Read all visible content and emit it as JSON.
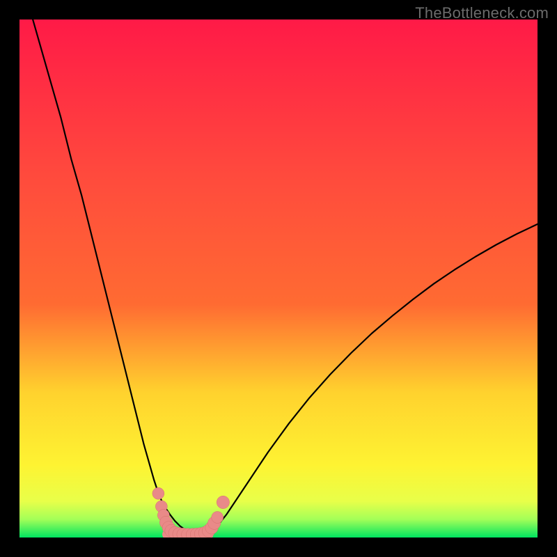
{
  "watermark": "TheBottleneck.com",
  "colors": {
    "bg": "#000000",
    "grad_top": "#ff1a47",
    "grad_mid_upper": "#ff6b32",
    "grad_mid": "#ffd22e",
    "grad_mid_lower": "#fef332",
    "grad_low": "#e8ff49",
    "grad_bottom": "#00e560",
    "curve": "#000000",
    "marker_fill": "#e98a88",
    "marker_stroke": "#d4706e"
  },
  "chart_data": {
    "type": "line",
    "title": "",
    "xlabel": "",
    "ylabel": "",
    "xlim": [
      0,
      100
    ],
    "ylim": [
      0,
      100
    ],
    "x": [
      0,
      2,
      4,
      6,
      8,
      10,
      12,
      14,
      16,
      18,
      20,
      22,
      24,
      26,
      27,
      28,
      29,
      30,
      31,
      32,
      33,
      34,
      35,
      36,
      37,
      38,
      40,
      44,
      48,
      52,
      56,
      60,
      64,
      68,
      72,
      76,
      80,
      84,
      88,
      92,
      96,
      100
    ],
    "series": [
      {
        "name": "bottleneck_curve",
        "values": [
          108,
          102,
          95,
          88,
          81,
          73,
          66,
          58,
          50,
          42,
          34,
          26,
          18,
          11,
          8,
          6,
          4.5,
          3.2,
          2.2,
          1.5,
          1.0,
          0.6,
          0.4,
          0.6,
          1.2,
          2.0,
          4.5,
          10.5,
          16.5,
          22,
          27,
          31.5,
          35.6,
          39.4,
          42.8,
          46,
          49,
          51.7,
          54.2,
          56.5,
          58.6,
          60.5
        ]
      }
    ],
    "flat_bottom": {
      "x_start": 28.5,
      "x_end": 36.5,
      "y": 0.6
    },
    "markers": [
      {
        "x": 26.8,
        "y": 8.5,
        "r": 1.2
      },
      {
        "x": 27.4,
        "y": 6.0,
        "r": 1.2
      },
      {
        "x": 27.8,
        "y": 4.3,
        "r": 1.2
      },
      {
        "x": 28.3,
        "y": 2.9,
        "r": 1.3
      },
      {
        "x": 28.8,
        "y": 1.9,
        "r": 1.3
      },
      {
        "x": 29.3,
        "y": 1.3,
        "r": 1.3
      },
      {
        "x": 30.0,
        "y": 0.9,
        "r": 1.3
      },
      {
        "x": 30.8,
        "y": 0.7,
        "r": 1.3
      },
      {
        "x": 31.6,
        "y": 0.6,
        "r": 1.3
      },
      {
        "x": 32.5,
        "y": 0.55,
        "r": 1.3
      },
      {
        "x": 33.4,
        "y": 0.55,
        "r": 1.3
      },
      {
        "x": 34.2,
        "y": 0.6,
        "r": 1.3
      },
      {
        "x": 35.0,
        "y": 0.7,
        "r": 1.3
      },
      {
        "x": 35.8,
        "y": 0.9,
        "r": 1.3
      },
      {
        "x": 36.5,
        "y": 1.3,
        "r": 1.3
      },
      {
        "x": 37.1,
        "y": 1.9,
        "r": 1.3
      },
      {
        "x": 37.6,
        "y": 2.8,
        "r": 1.3
      },
      {
        "x": 38.2,
        "y": 3.9,
        "r": 1.2
      },
      {
        "x": 39.3,
        "y": 6.8,
        "r": 1.3
      }
    ]
  }
}
